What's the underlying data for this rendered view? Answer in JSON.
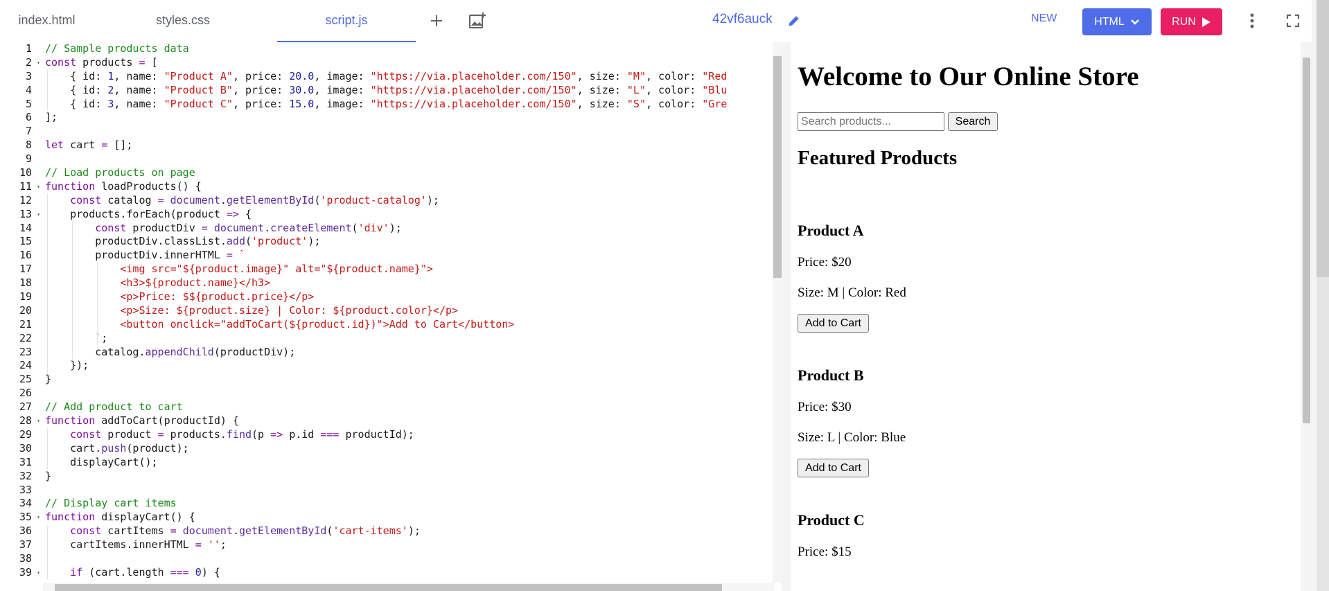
{
  "tabs": [
    {
      "label": "index.html",
      "active": false
    },
    {
      "label": "styles.css",
      "active": false
    },
    {
      "label": "script.js",
      "active": true
    }
  ],
  "toolbar": {
    "add_tab_icon": "plus-icon",
    "add_image_icon": "add-image-icon",
    "fiddle_name": "42vf6auck",
    "edit_icon": "pencil-icon",
    "new_label": "NEW",
    "language_label": "HTML",
    "run_label": "RUN",
    "more_icon": "more-vertical-icon",
    "fullscreen_icon": "fullscreen-icon"
  },
  "colors": {
    "accent": "#4f6ce9",
    "run": "#e91e63"
  },
  "editor": {
    "language": "javascript",
    "line_numbers": [
      "1",
      "2",
      "3",
      "4",
      "5",
      "6",
      "7",
      "8",
      "9",
      "10",
      "11",
      "12",
      "13",
      "14",
      "15",
      "16",
      "17",
      "18",
      "19",
      "20",
      "21",
      "22",
      "23",
      "24",
      "25",
      "26",
      "27",
      "28",
      "29",
      "30",
      "31",
      "32",
      "33",
      "34",
      "35",
      "36",
      "37",
      "38",
      "39"
    ],
    "fold_lines": [
      2,
      11,
      13,
      28,
      35,
      39
    ],
    "lines": [
      "// Sample products data",
      "const products = [",
      "    { id: 1, name: \"Product A\", price: 20.0, image: \"https://via.placeholder.com/150\", size: \"M\", color: \"Red",
      "    { id: 2, name: \"Product B\", price: 30.0, image: \"https://via.placeholder.com/150\", size: \"L\", color: \"Blu",
      "    { id: 3, name: \"Product C\", price: 15.0, image: \"https://via.placeholder.com/150\", size: \"S\", color: \"Gre",
      "];",
      "",
      "let cart = [];",
      "",
      "// Load products on page",
      "function loadProducts() {",
      "    const catalog = document.getElementById('product-catalog');",
      "    products.forEach(product => {",
      "        const productDiv = document.createElement('div');",
      "        productDiv.classList.add('product');",
      "        productDiv.innerHTML = `",
      "            <img src=\"${product.image}\" alt=\"${product.name}\">",
      "            <h3>${product.name}</h3>",
      "            <p>Price: $${product.price}</p>",
      "            <p>Size: ${product.size} | Color: ${product.color}</p>",
      "            <button onclick=\"addToCart(${product.id})\">Add to Cart</button>",
      "        `;",
      "        catalog.appendChild(productDiv);",
      "    });",
      "}",
      "",
      "// Add product to cart",
      "function addToCart(productId) {",
      "    const product = products.find(p => p.id === productId);",
      "    cart.push(product);",
      "    displayCart();",
      "}",
      "",
      "// Display cart items",
      "function displayCart() {",
      "    const cartItems = document.getElementById('cart-items');",
      "    cartItems.innerHTML = '';",
      "",
      "    if (cart.length === 0) {"
    ]
  },
  "preview": {
    "heading": "Welcome to Our Online Store",
    "search_placeholder": "Search products...",
    "search_button": "Search",
    "featured_heading": "Featured Products",
    "products": [
      {
        "name": "Product A",
        "price": "Price: $20",
        "details": "Size: M | Color: Red",
        "button": "Add to Cart"
      },
      {
        "name": "Product B",
        "price": "Price: $30",
        "details": "Size: L | Color: Blue",
        "button": "Add to Cart"
      },
      {
        "name": "Product C",
        "price": "Price: $15"
      }
    ]
  }
}
